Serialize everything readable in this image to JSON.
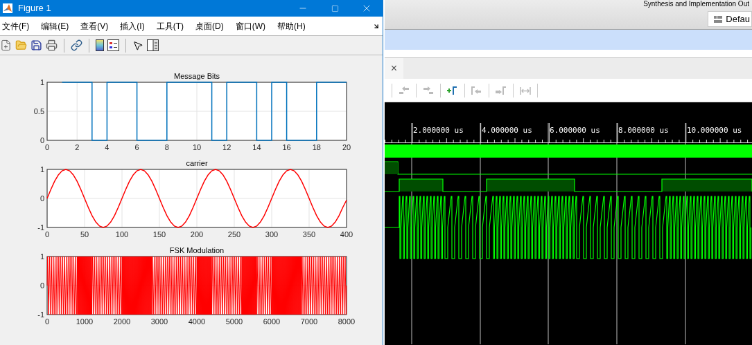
{
  "figure_window": {
    "title": "Figure 1",
    "menu": [
      "文件(F)",
      "编辑(E)",
      "查看(V)",
      "插入(I)",
      "工具(T)",
      "桌面(D)",
      "窗口(W)",
      "帮助(H)"
    ],
    "subplots": [
      {
        "kind": "bits",
        "chart_data": {
          "type": "line",
          "title": "Message Bits",
          "x": [
            1,
            3,
            3,
            4,
            4,
            6,
            6,
            8,
            8,
            11,
            11,
            12,
            12,
            14,
            14,
            15,
            15,
            16,
            16,
            18,
            18,
            20
          ],
          "values": [
            1,
            1,
            0,
            0,
            1,
            1,
            0,
            0,
            1,
            1,
            0,
            0,
            1,
            1,
            0,
            0,
            1,
            1,
            0,
            0,
            1,
            1
          ],
          "xlim": [
            0,
            20
          ],
          "ylim": [
            0,
            1
          ],
          "xticks": [
            0,
            2,
            4,
            6,
            8,
            10,
            12,
            14,
            16,
            18,
            20
          ],
          "yticks": [
            0,
            0.5,
            1
          ],
          "grid": true
        }
      },
      {
        "kind": "sine",
        "chart_data": {
          "type": "line",
          "title": "carrier",
          "x": [
            0,
            5,
            10,
            15,
            20,
            25,
            30,
            35,
            40,
            45,
            50,
            55,
            60,
            65,
            70,
            75,
            80,
            85,
            90,
            95,
            100,
            105,
            110,
            115,
            120,
            125,
            130,
            135,
            140,
            145,
            150,
            155,
            160,
            165,
            170,
            175,
            180,
            185,
            190,
            195,
            200,
            205,
            210,
            215,
            220,
            225,
            230,
            235,
            240,
            245,
            250,
            255,
            260,
            265,
            270,
            275,
            280,
            285,
            290,
            295,
            300,
            305,
            310,
            315,
            320,
            325,
            330,
            335,
            340,
            345,
            350,
            355,
            360,
            365,
            370,
            375,
            380,
            385,
            390,
            395,
            400
          ],
          "values": [
            0,
            0.31,
            0.59,
            0.81,
            0.95,
            1,
            0.95,
            0.81,
            0.59,
            0.31,
            0,
            -0.31,
            -0.59,
            -0.81,
            -0.95,
            -1,
            -0.95,
            -0.81,
            -0.59,
            -0.31,
            0,
            0.31,
            0.59,
            0.81,
            0.95,
            1,
            0.95,
            0.81,
            0.59,
            0.31,
            0,
            -0.31,
            -0.59,
            -0.81,
            -0.95,
            -1,
            -0.95,
            -0.81,
            -0.59,
            -0.31,
            0,
            0.31,
            0.59,
            0.81,
            0.95,
            1,
            0.95,
            0.81,
            0.59,
            0.31,
            0,
            -0.31,
            -0.59,
            -0.81,
            -0.95,
            -1,
            -0.95,
            -0.81,
            -0.59,
            -0.31,
            0,
            0.31,
            0.59,
            0.81,
            0.95,
            1,
            0.95,
            0.81,
            0.59,
            0.31,
            0,
            -0.31,
            -0.59,
            -0.81,
            -0.95,
            -1,
            -0.95,
            -0.81,
            -0.59,
            -0.31,
            -0.06
          ],
          "xlim": [
            0,
            400
          ],
          "ylim": [
            -1,
            1
          ],
          "xticks": [
            0,
            50,
            100,
            150,
            200,
            250,
            300,
            350,
            400
          ],
          "yticks": [
            -1,
            0,
            1
          ],
          "grid": true
        }
      },
      {
        "kind": "fsk",
        "title": "FSK Modulation",
        "xticks": [
          "0",
          "1000",
          "2000",
          "3000",
          "4000",
          "5000",
          "6000",
          "7000",
          "8000"
        ],
        "yticks": [
          "1",
          "0",
          "-1"
        ]
      }
    ]
  },
  "ide": {
    "header_text": "Synthesis and Implementation Out",
    "layout_button": "Defau",
    "tab_close": "×",
    "time_labels": [
      "2.000000 us",
      "4.000000 us",
      "6.000000 us",
      "8.000000 us",
      "10.000000 us"
    ]
  }
}
